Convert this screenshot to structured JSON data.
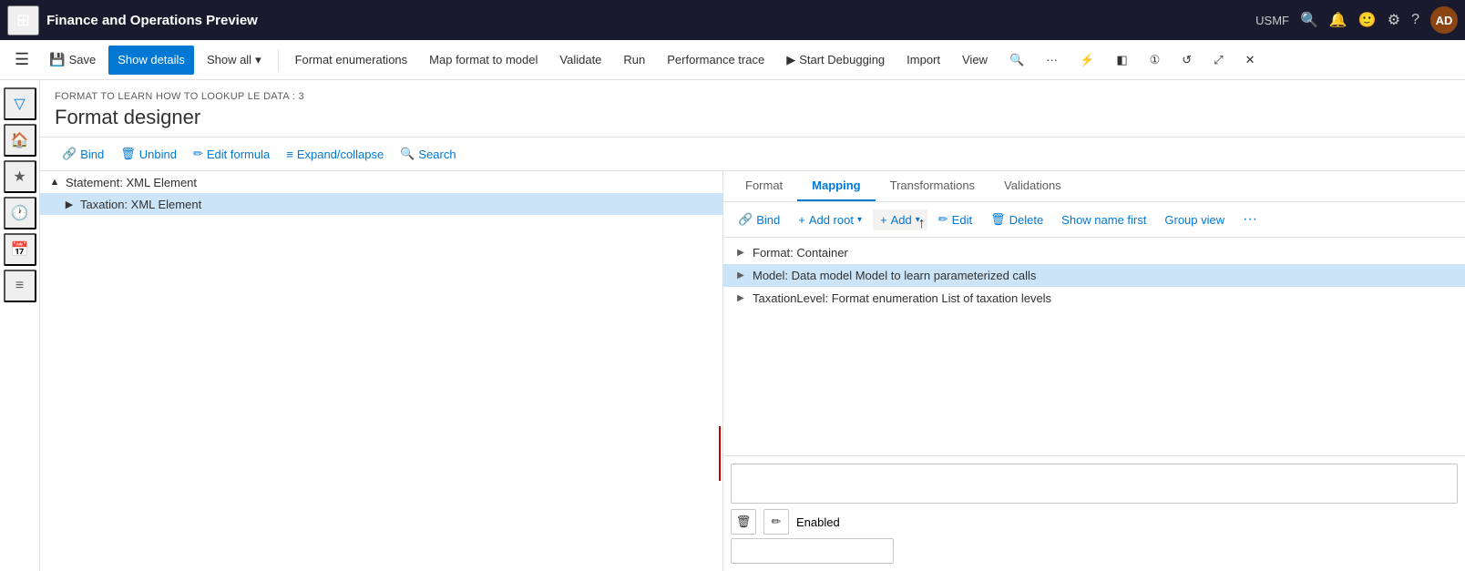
{
  "topbar": {
    "grid_icon": "⊞",
    "title": "Finance and Operations Preview",
    "usmf_label": "USMF",
    "search_icon": "🔍",
    "bell_icon": "🔔",
    "smile_icon": "🙂",
    "gear_icon": "⚙",
    "help_icon": "?",
    "avatar_text": "AD"
  },
  "actionbar": {
    "hamburger_icon": "☰",
    "save_label": "Save",
    "save_icon": "💾",
    "show_details_label": "Show details",
    "show_all_label": "Show all",
    "chevron_down": "▾",
    "format_enum_label": "Format enumerations",
    "map_format_label": "Map format to model",
    "validate_label": "Validate",
    "run_label": "Run",
    "perf_trace_label": "Performance trace",
    "start_debug_label": "Start Debugging",
    "start_debug_icon": "▶",
    "import_label": "Import",
    "view_label": "View",
    "search_icon": "🔍",
    "more_icon": "...",
    "extra_icons": [
      "⚡",
      "◧",
      "①",
      "↺",
      "⤢",
      "✕"
    ]
  },
  "sidebar": {
    "icons": [
      "🏠",
      "★",
      "🕐",
      "📅",
      "≡"
    ]
  },
  "page": {
    "breadcrumb": "FORMAT TO LEARN HOW TO LOOKUP LE DATA : 3",
    "title": "Format designer"
  },
  "format_toolbar": {
    "bind_icon": "🔗",
    "bind_label": "Bind",
    "unbind_icon": "🗑",
    "unbind_label": "Unbind",
    "edit_formula_icon": "✏",
    "edit_formula_label": "Edit formula",
    "expand_icon": "≡",
    "expand_label": "Expand/collapse",
    "search_icon": "🔍",
    "search_label": "Search"
  },
  "tree": {
    "items": [
      {
        "id": "statement",
        "level": 0,
        "expand_icon": "▲",
        "label": "Statement: XML Element",
        "selected": false
      },
      {
        "id": "taxation",
        "level": 1,
        "expand_icon": "▶",
        "label": "Taxation: XML Element",
        "selected": true
      }
    ]
  },
  "mapping_tabs": [
    {
      "id": "format",
      "label": "Format",
      "active": false
    },
    {
      "id": "mapping",
      "label": "Mapping",
      "active": true
    },
    {
      "id": "transformations",
      "label": "Transformations",
      "active": false
    },
    {
      "id": "validations",
      "label": "Validations",
      "active": false
    }
  ],
  "mapping_toolbar": {
    "bind_icon": "🔗",
    "bind_label": "Bind",
    "add_root_icon": "+",
    "add_root_label": "Add root",
    "chevron": "▾",
    "add_icon": "+",
    "add_label": "Add",
    "edit_icon": "✏",
    "edit_label": "Edit",
    "delete_icon": "🗑",
    "delete_label": "Delete",
    "show_name_first_label": "Show name first",
    "group_view_label": "Group view",
    "more_label": "···"
  },
  "datasources": [
    {
      "id": "format-container",
      "expand_icon": "▶",
      "label": "Format: Container",
      "highlighted": false
    },
    {
      "id": "model-data",
      "expand_icon": "▶",
      "label": "Model: Data model Model to learn parameterized calls",
      "highlighted": true
    },
    {
      "id": "taxation-level",
      "expand_icon": "▶",
      "label": "TaxationLevel: Format enumeration List of taxation levels",
      "highlighted": false
    }
  ],
  "bottom": {
    "delete_icon": "🗑",
    "edit_icon": "✏",
    "enabled_label": "Enabled",
    "formula_placeholder": ""
  }
}
